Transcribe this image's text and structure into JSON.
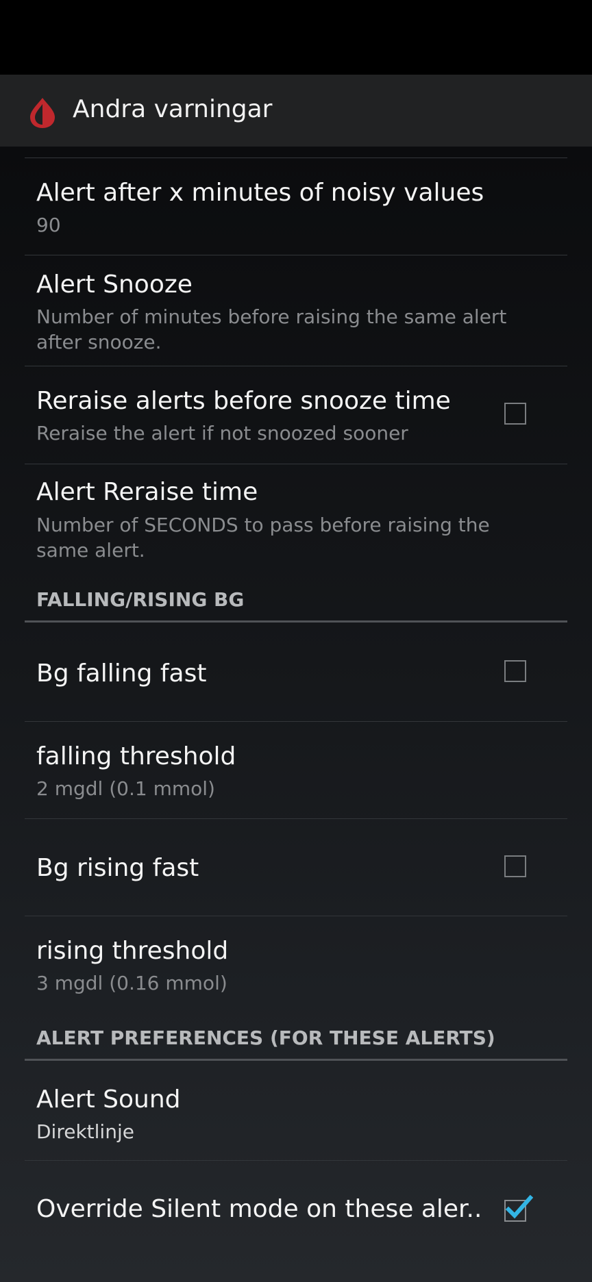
{
  "app": {
    "title": "Andra varningar",
    "icon": "blood-drop-icon",
    "accent": "#c0282d"
  },
  "preferences": [
    {
      "id": "noisy",
      "title": "Alert after x minutes of noisy values",
      "summary": "90"
    },
    {
      "id": "snooze",
      "title": "Alert Snooze",
      "summary": "Number of minutes before raising the same alert after snooze."
    },
    {
      "id": "reraise",
      "title": "Reraise alerts before snooze time",
      "summary": "Reraise the alert if not snoozed sooner",
      "checked": false
    },
    {
      "id": "reraise_time",
      "title": "Alert Reraise time",
      "summary": "Number of SECONDS to pass before raising the same alert."
    }
  ],
  "categories": {
    "falling_rising": {
      "title": "FALLING/RISING BG",
      "items": [
        {
          "id": "falling",
          "title": "Bg falling fast",
          "checked": false
        },
        {
          "id": "falling_threshold",
          "title": "falling threshold",
          "summary": "2 mgdl (0.1 mmol)"
        },
        {
          "id": "rising",
          "title": "Bg rising fast",
          "checked": false
        },
        {
          "id": "rising_threshold",
          "title": "rising threshold",
          "summary": "3 mgdl (0.16 mmol)"
        }
      ]
    },
    "alert_prefs": {
      "title": "ALERT PREFERENCES (FOR THESE ALERTS)",
      "items": [
        {
          "id": "sound",
          "title": "Alert Sound",
          "summary": "Direktlinje"
        },
        {
          "id": "override_silent",
          "title": "Override Silent mode on these aler..",
          "checked": true
        }
      ]
    }
  },
  "colors": {
    "check_mark": "#33b5e5"
  }
}
